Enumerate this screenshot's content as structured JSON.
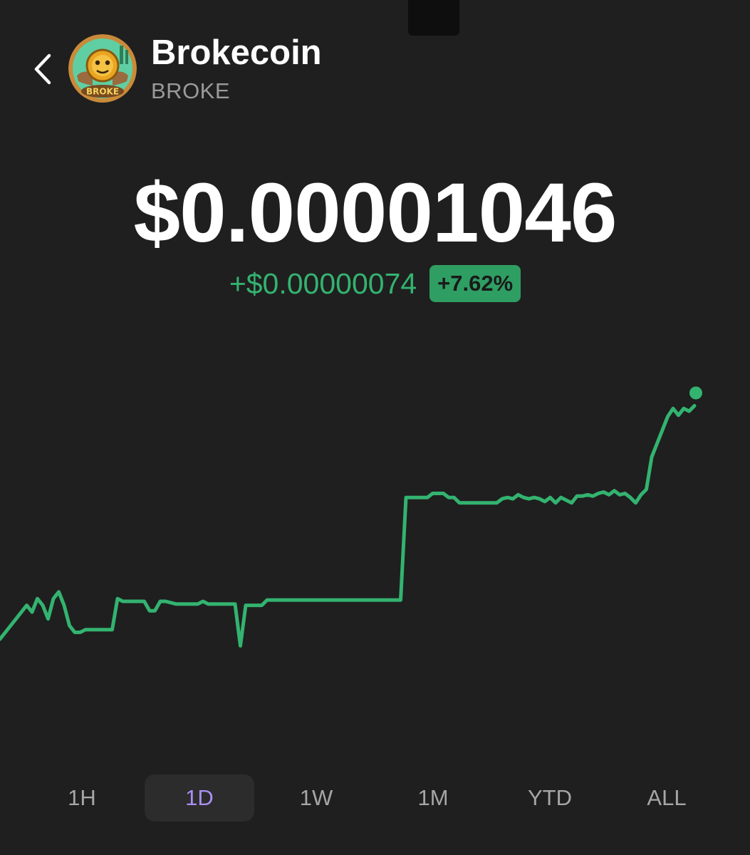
{
  "coin": {
    "name": "Brokecoin",
    "symbol": "BROKE",
    "logo_text": "BROKE"
  },
  "price": {
    "value": "$0.00001046",
    "change_abs": "+$0.00000074",
    "change_pct": "+7.62%"
  },
  "ranges": [
    {
      "label": "1H",
      "selected": false
    },
    {
      "label": "1D",
      "selected": true
    },
    {
      "label": "1W",
      "selected": false
    },
    {
      "label": "1M",
      "selected": false
    },
    {
      "label": "YTD",
      "selected": false
    },
    {
      "label": "ALL",
      "selected": false
    }
  ],
  "colors": {
    "background": "#1f1f1f",
    "positive": "#33b370",
    "badge": "#2f9e63",
    "selected_range": "#a98ff5",
    "muted": "#9a9a9a"
  },
  "icons": {
    "back": "chevron-left-icon",
    "endpoint": "live-dot-icon"
  },
  "chart_data": {
    "type": "line",
    "series_color": "#33b370",
    "values": [
      9.65,
      9.7,
      9.75,
      9.8,
      9.85,
      9.9,
      9.85,
      9.95,
      9.9,
      9.8,
      9.95,
      10.0,
      9.9,
      9.75,
      9.7,
      9.7,
      9.72,
      9.72,
      9.72,
      9.72,
      9.72,
      9.72,
      9.95,
      9.93,
      9.93,
      9.93,
      9.93,
      9.93,
      9.86,
      9.86,
      9.93,
      9.93,
      9.92,
      9.91,
      9.91,
      9.91,
      9.91,
      9.91,
      9.93,
      9.91,
      9.91,
      9.91,
      9.91,
      9.91,
      9.91,
      9.6,
      9.9,
      9.9,
      9.9,
      9.9,
      9.94,
      9.94,
      9.94,
      9.94,
      9.94,
      9.94,
      9.94,
      9.94,
      9.94,
      9.94,
      9.94,
      9.94,
      9.94,
      9.94,
      9.94,
      9.94,
      9.94,
      9.94,
      9.94,
      9.94,
      9.94,
      9.94,
      9.94,
      9.94,
      9.94,
      9.94,
      10.7,
      10.7,
      10.7,
      10.7,
      10.7,
      10.73,
      10.73,
      10.73,
      10.7,
      10.7,
      10.66,
      10.66,
      10.66,
      10.66,
      10.66,
      10.66,
      10.66,
      10.66,
      10.69,
      10.7,
      10.69,
      10.72,
      10.7,
      10.69,
      10.7,
      10.69,
      10.67,
      10.7,
      10.66,
      10.7,
      10.68,
      10.66,
      10.71,
      10.71,
      10.72,
      10.71,
      10.73,
      10.74,
      10.72,
      10.75,
      10.72,
      10.73,
      10.7,
      10.66,
      10.72,
      10.76,
      11.0,
      11.1,
      11.2,
      11.3,
      11.36,
      11.31,
      11.36,
      11.34,
      11.38
    ],
    "ylim": [
      9.0,
      11.8
    ],
    "endpoint_marker": true
  }
}
